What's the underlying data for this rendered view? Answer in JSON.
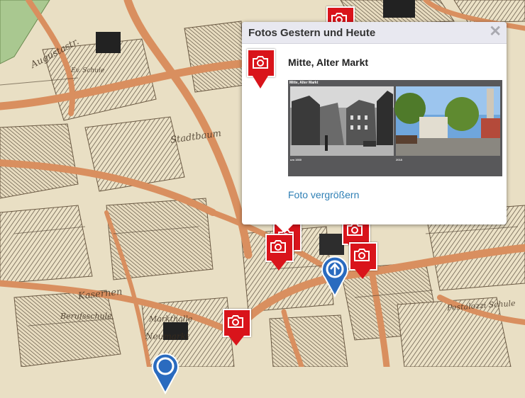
{
  "popup": {
    "title": "Fotos Gestern und Heute",
    "close_label": "✕",
    "place": "Mitte, Alter Markt",
    "photo_header": "Mitte, Alter Markt",
    "photo_year_left": "um 1930",
    "photo_year_right": "2018",
    "enlarge_link": "Foto vergrößern"
  },
  "map_labels": {
    "street_a": "Augustastr.",
    "school_a": "Ev. Schule",
    "street_b": "Kasernen",
    "school_b": "Berufsschule",
    "hall": "Markthalle",
    "square": "Neumarkt",
    "school_c": "Pestalozzi Schule",
    "street_c": "Stadtbaum"
  },
  "colors": {
    "photo_marker": "#d9141b",
    "poi_marker": "#2a6bbf",
    "link": "#2e7fb5",
    "street": "#d98f5f",
    "paper": "#e9dfc4"
  },
  "icons": {
    "photo_marker": "camera-icon",
    "poi_marker": "blue-poi-icon"
  }
}
